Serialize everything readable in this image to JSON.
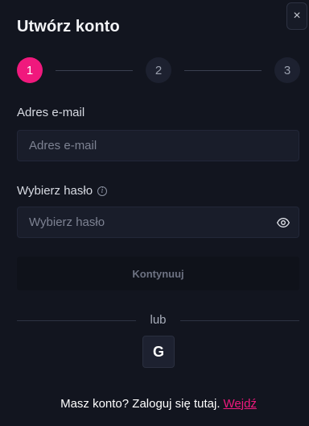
{
  "dialog": {
    "title": "Utwórz konto",
    "close_label": "×"
  },
  "stepper": {
    "steps": [
      "1",
      "2",
      "3"
    ],
    "active_step": 1,
    "accent_color": "#f0197d"
  },
  "email": {
    "label": "Adres e-mail",
    "placeholder": "Adres e-mail",
    "value": ""
  },
  "password": {
    "label": "Wybierz hasło",
    "info_icon": "info-icon",
    "placeholder": "Wybierz hasło",
    "value": "",
    "toggle_icon": "eye-icon"
  },
  "continue_button": {
    "label": "Kontynuuj"
  },
  "divider": {
    "text": "lub"
  },
  "social": {
    "google_label": "G"
  },
  "footer": {
    "text": "Masz konto? Zaloguj się tutaj.",
    "link_text": "Wejdź"
  }
}
